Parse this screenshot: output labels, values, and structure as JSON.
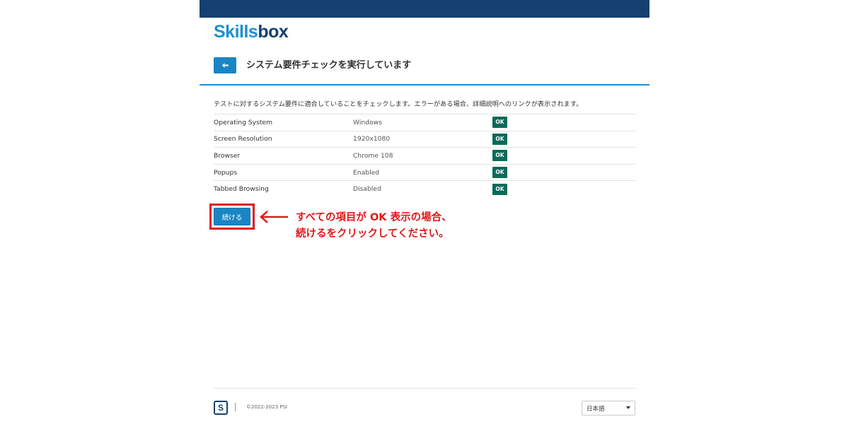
{
  "header": {
    "logo_part1": "Skills",
    "logo_part2": "box",
    "page_title": "システム要件チェックを実行しています"
  },
  "main": {
    "intro": "テストに対するシステム要件に適合していることをチェックします。エラーがある場合、詳細説明へのリンクが表示されます。",
    "requirements": [
      {
        "label": "Operating System",
        "value": "Windows",
        "status": "OK"
      },
      {
        "label": "Screen Resolution",
        "value": "1920x1080",
        "status": "OK"
      },
      {
        "label": "Browser",
        "value": "Chrome 108",
        "status": "OK"
      },
      {
        "label": "Popups",
        "value": "Enabled",
        "status": "OK"
      },
      {
        "label": "Tabbed Browsing",
        "value": "Disabled",
        "status": "OK"
      }
    ],
    "continue_label": "続ける"
  },
  "annotation": {
    "line1": "すべての項目が OK 表示の場合、",
    "line2": "続けるをクリックしてください。"
  },
  "footer": {
    "logo_glyph": "S",
    "copyright": "©2022-2023 PSI",
    "language": "日本語"
  },
  "colors": {
    "brand_dark": "#15406f",
    "brand_blue": "#1e8fd0",
    "button_blue": "#1a85c5",
    "ok_green": "#0a6b58",
    "annotation_red": "#e01818"
  },
  "icons": {
    "back": "arrow-left-icon",
    "annotation_arrow": "arrow-left-icon",
    "select_caret": "caret-down-icon"
  }
}
